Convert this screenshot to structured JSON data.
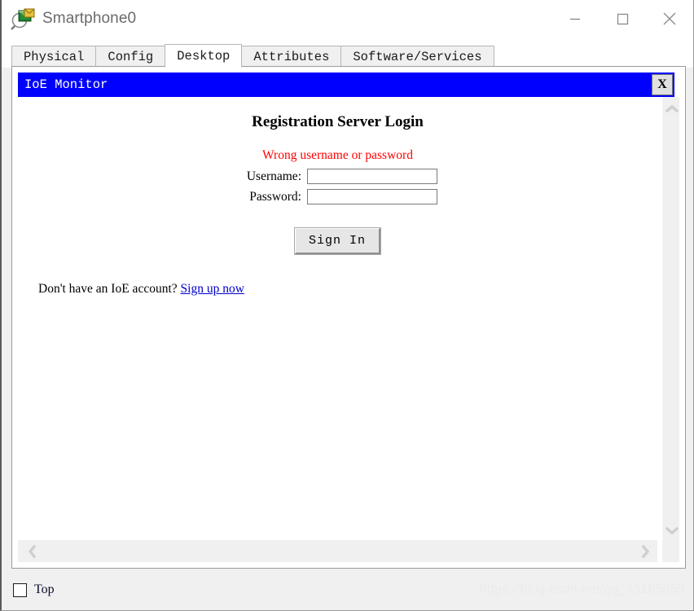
{
  "window": {
    "title": "Smartphone0",
    "icon": "inspect-envelope-icon",
    "minimize_label": "minimize-icon",
    "maximize_label": "maximize-icon",
    "close_label": "close-icon"
  },
  "tabs": [
    {
      "label": "Physical",
      "active": false
    },
    {
      "label": "Config",
      "active": false
    },
    {
      "label": "Desktop",
      "active": true
    },
    {
      "label": "Attributes",
      "active": false
    },
    {
      "label": "Software/Services",
      "active": false
    }
  ],
  "ioe_window": {
    "title": "IoE Monitor",
    "close_label": "X",
    "titlebar_color": "#0000ff"
  },
  "page": {
    "heading": "Registration Server Login",
    "error_message": "Wrong username or password",
    "error_color": "#ff0000",
    "fields": [
      {
        "label": "Username:",
        "value": "",
        "placeholder": "",
        "type": "text"
      },
      {
        "label": "Password:",
        "value": "",
        "placeholder": "",
        "type": "password"
      }
    ],
    "submit_label": "Sign In",
    "signup_prompt": "Don't have an IoE account?",
    "signup_link": "Sign up now",
    "link_color": "#0000cc"
  },
  "scrollbars": {
    "up_arrow": "chevron-up-icon",
    "down_arrow": "chevron-down-icon",
    "left_arrow": "chevron-left-icon",
    "right_arrow": "chevron-right-icon"
  },
  "footer": {
    "top_checkbox_label": "Top",
    "top_checkbox_checked": false,
    "watermark": "https://blog.csdn.net/qq_43185059"
  }
}
